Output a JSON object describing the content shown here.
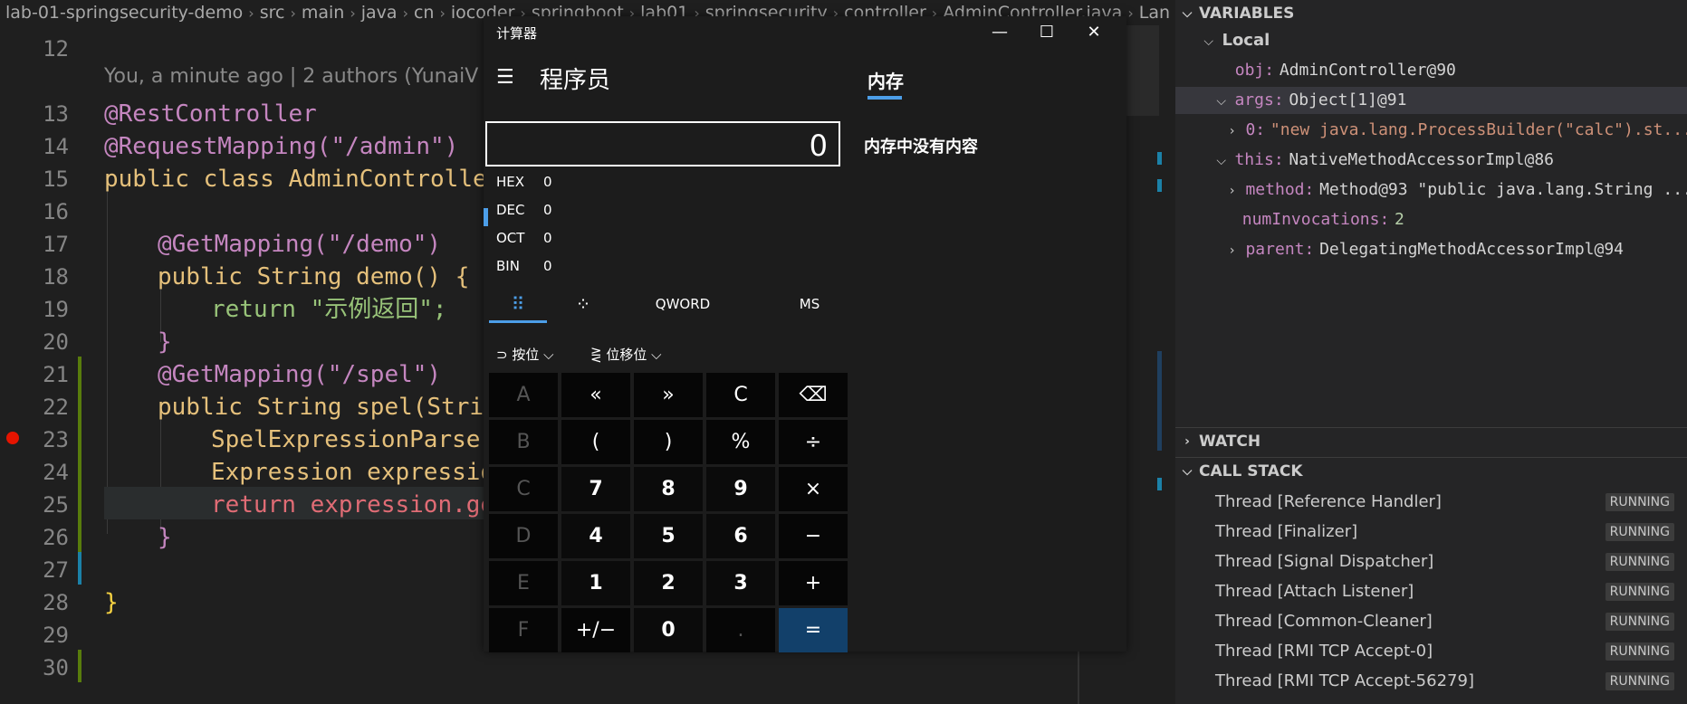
{
  "breadcrumb": [
    "lab-01-springsecurity-demo",
    "src",
    "main",
    "java",
    "cn",
    "iocoder",
    "springboot",
    "lab01",
    "springsecurity",
    "controller",
    "AdminController.java",
    "Lan"
  ],
  "editor": {
    "blame": "You, a minute ago | 2 authors (YunaiV and others)",
    "lines": [
      {
        "n": "12",
        "t": ""
      },
      {
        "n": "13",
        "t": "@RestController"
      },
      {
        "n": "14",
        "t": "@RequestMapping(\"/admin\")"
      },
      {
        "n": "15",
        "t": "public class AdminController {"
      },
      {
        "n": "16",
        "t": ""
      },
      {
        "n": "17",
        "t": "@GetMapping(\"/demo\")"
      },
      {
        "n": "18",
        "t": "public String demo() {"
      },
      {
        "n": "19",
        "t": "return \"示例返回\";"
      },
      {
        "n": "20",
        "t": "}"
      },
      {
        "n": "21",
        "t": "@GetMapping(\"/spel\")"
      },
      {
        "n": "22",
        "t": "public String spel(String"
      },
      {
        "n": "23",
        "t": "SpelExpressionParser"
      },
      {
        "n": "24",
        "t": "Expression expression"
      },
      {
        "n": "25",
        "t": "return expression.get"
      },
      {
        "n": "26",
        "t": "}"
      },
      {
        "n": "27",
        "t": ""
      },
      {
        "n": "28",
        "t": "}"
      },
      {
        "n": "29",
        "t": ""
      },
      {
        "n": "30",
        "t": ""
      }
    ]
  },
  "debug": {
    "variables_title": "VARIABLES",
    "local_label": "Local",
    "obj_name": "obj:",
    "obj_val": "AdminController@90",
    "args_name": "args:",
    "args_val": "Object[1]@91",
    "arg0_name": "0:",
    "arg0_val": "\"new java.lang.ProcessBuilder(\"calc\").st...",
    "this_name": "this:",
    "this_val": "NativeMethodAccessorImpl@86",
    "method_name": "method:",
    "method_val": "Method@93 \"public java.lang.String ...",
    "numinv_name": "numInvocations:",
    "numinv_val": "2",
    "parent_name": "parent:",
    "parent_val": "DelegatingMethodAccessorImpl@94",
    "watch_title": "WATCH",
    "callstack_title": "CALL STACK",
    "threads": [
      {
        "name": "Thread [Reference Handler]",
        "status": "RUNNING"
      },
      {
        "name": "Thread [Finalizer]",
        "status": "RUNNING"
      },
      {
        "name": "Thread [Signal Dispatcher]",
        "status": "RUNNING"
      },
      {
        "name": "Thread [Attach Listener]",
        "status": "RUNNING"
      },
      {
        "name": "Thread [Common-Cleaner]",
        "status": "RUNNING"
      },
      {
        "name": "Thread [RMI TCP Accept-0]",
        "status": "RUNNING"
      },
      {
        "name": "Thread [RMI TCP Accept-56279]",
        "status": "RUNNING"
      }
    ]
  },
  "calc": {
    "title": "计算器",
    "mode": "程序员",
    "memory_tab": "内存",
    "memory_empty": "内存中没有内容",
    "display": "0",
    "bases": [
      {
        "label": "HEX",
        "value": "0"
      },
      {
        "label": "DEC",
        "value": "0"
      },
      {
        "label": "OCT",
        "value": "0"
      },
      {
        "label": "BIN",
        "value": "0"
      }
    ],
    "word_size": "QWORD",
    "ms": "MS",
    "bitwise": "按位",
    "bitshift": "位移位",
    "keys": [
      [
        "A",
        "«",
        "»",
        "C",
        "⌫"
      ],
      [
        "B",
        "(",
        ")",
        "%",
        "÷"
      ],
      [
        "C",
        "7",
        "8",
        "9",
        "×"
      ],
      [
        "D",
        "4",
        "5",
        "6",
        "−"
      ],
      [
        "E",
        "1",
        "2",
        "3",
        "+"
      ],
      [
        "F",
        "+/−",
        "0",
        ".",
        "="
      ]
    ]
  }
}
